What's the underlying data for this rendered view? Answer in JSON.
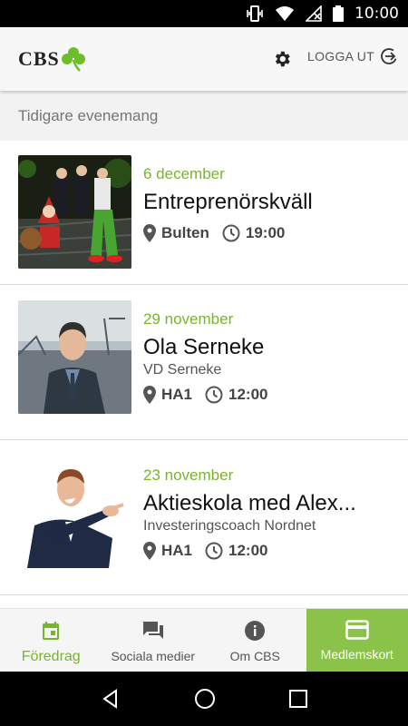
{
  "status_bar": {
    "time": "10:00"
  },
  "header": {
    "logo_text": "CBS",
    "logout_label": "LOGGA UT"
  },
  "section": {
    "title": "Tidigare evenemang"
  },
  "events": [
    {
      "date": "6 december",
      "title": "Entreprenörskväll",
      "subtitle": "",
      "location": "Bulten",
      "time": "19:00"
    },
    {
      "date": "29 november",
      "title": "Ola Serneke",
      "subtitle": "VD Serneke",
      "location": "HA1",
      "time": "12:00"
    },
    {
      "date": "23 november",
      "title": "Aktieskola med Alex...",
      "subtitle": "Investeringscoach Nordnet",
      "location": "HA1",
      "time": "12:00"
    }
  ],
  "bottom_nav": [
    {
      "label": "Föredrag",
      "icon": "calendar-icon"
    },
    {
      "label": "Sociala medier",
      "icon": "chat-icon"
    },
    {
      "label": "Om CBS",
      "icon": "info-icon"
    },
    {
      "label": "Medlemskort",
      "icon": "card-icon"
    }
  ],
  "colors": {
    "accent": "#79b52c",
    "highlight": "#8bc34a"
  }
}
